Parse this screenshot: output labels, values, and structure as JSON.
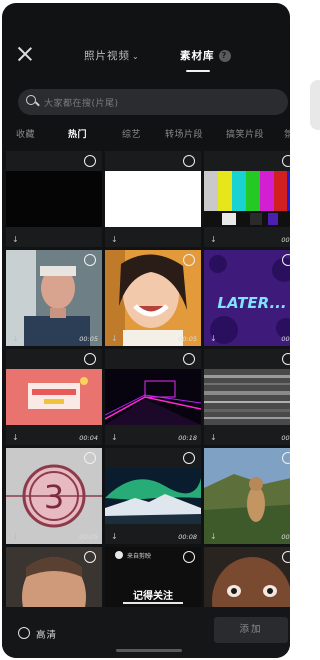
{
  "header": {
    "tab_photos": "照片视频",
    "tab_library": "素材库",
    "help_glyph": "?"
  },
  "search": {
    "placeholder": "大家都在搜(片尾)"
  },
  "categories": [
    {
      "label": "收藏",
      "active": false
    },
    {
      "label": "热门",
      "active": true
    },
    {
      "label": "综艺",
      "active": false
    },
    {
      "label": "转场片段",
      "active": false
    },
    {
      "label": "搞笑片段",
      "active": false
    },
    {
      "label": "氛",
      "active": false
    }
  ],
  "tiles": [
    {
      "duration": "",
      "kind": "black"
    },
    {
      "duration": "",
      "kind": "white"
    },
    {
      "duration": "00:0",
      "kind": "color-bars"
    },
    {
      "duration": "00:05",
      "kind": "man-portrait"
    },
    {
      "duration": "00:05",
      "kind": "woman-smile"
    },
    {
      "duration": "00:0",
      "kind": "later-text",
      "overlay_text": "LATER..."
    },
    {
      "duration": "00:04",
      "kind": "pink-card"
    },
    {
      "duration": "00:18",
      "kind": "neon-corridor"
    },
    {
      "duration": "00:0",
      "kind": "static-noise"
    },
    {
      "duration": "00:05",
      "kind": "countdown",
      "overlay_text": "3"
    },
    {
      "duration": "00:08",
      "kind": "aurora"
    },
    {
      "duration": "00:0",
      "kind": "marmot"
    },
    {
      "duration": "",
      "kind": "man-laugh"
    },
    {
      "duration": "",
      "kind": "subscribe",
      "overlay_text": "记得关注",
      "badge_text": "来自剪映"
    },
    {
      "duration": "",
      "kind": "man-close"
    }
  ],
  "footer": {
    "hd_label": "高清",
    "add_button": "添加"
  }
}
